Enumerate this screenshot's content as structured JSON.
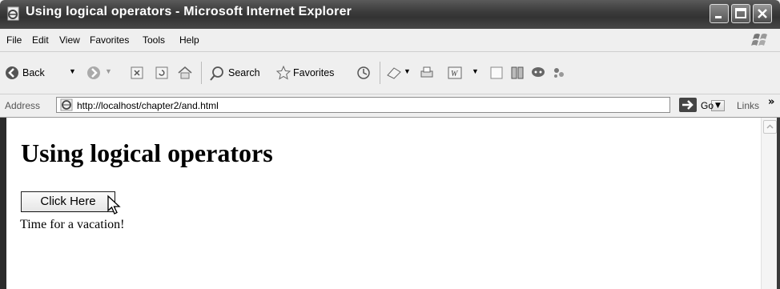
{
  "window": {
    "title": "Using logical operators - Microsoft Internet Explorer"
  },
  "menu": [
    "File",
    "Edit",
    "View",
    "Favorites",
    "Tools",
    "Help"
  ],
  "toolbar": {
    "back_label": "Back",
    "search_label": "Search",
    "favorites_label": "Favorites",
    "icons": [
      "back-icon",
      "dropdown-icon",
      "forward-icon",
      "stop-icon",
      "refresh-icon",
      "home-icon",
      "search-icon",
      "favorites-star-icon",
      "history-icon",
      "mail-icon",
      "print-icon",
      "edit-word-icon",
      "discuss-icon",
      "research-icon",
      "messenger-icon",
      "bluetooth-icon"
    ]
  },
  "address": {
    "label": "Address",
    "url": "http://localhost/chapter2/and.html",
    "go_label": "Go",
    "links_label": "Links"
  },
  "page": {
    "heading": "Using logical operators",
    "button_label": "Click Here",
    "result_text": "Time for a vacation!"
  }
}
